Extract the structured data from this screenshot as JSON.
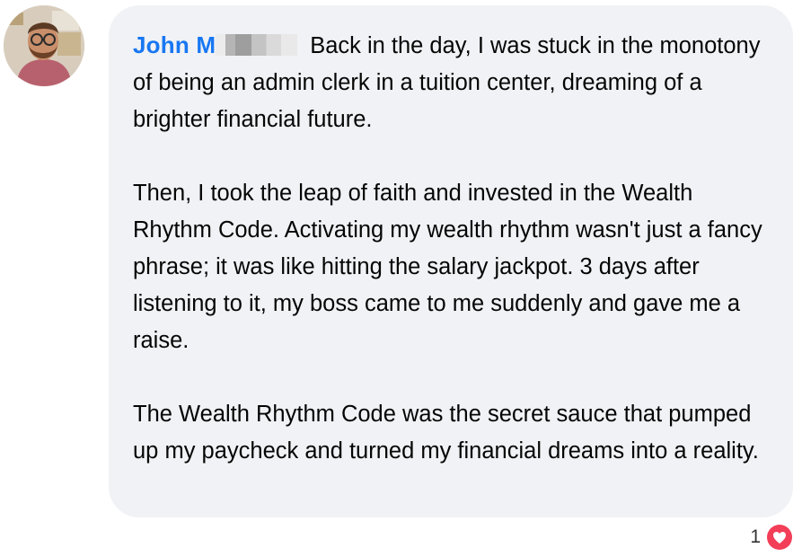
{
  "comment": {
    "author": "John M",
    "author_color": "#1877f2",
    "paragraphs": [
      "Back in the day, I was stuck in the monotony of being an admin clerk in a tuition center, dreaming of a brighter financial future.",
      "Then, I took the leap of faith and invested in the Wealth Rhythm Code. Activating my wealth rhythm wasn't just a fancy phrase; it was like hitting the salary jackpot. 3 days after listening to it, my boss came to me suddenly and gave me a raise.",
      "The Wealth Rhythm Code was the secret sauce that pumped up my paycheck and turned my financial dreams into a reality."
    ],
    "bubble_color": "#f0f2f5"
  },
  "reactions": {
    "count": "1",
    "icon": "heart-icon",
    "color": "#f33e58"
  }
}
